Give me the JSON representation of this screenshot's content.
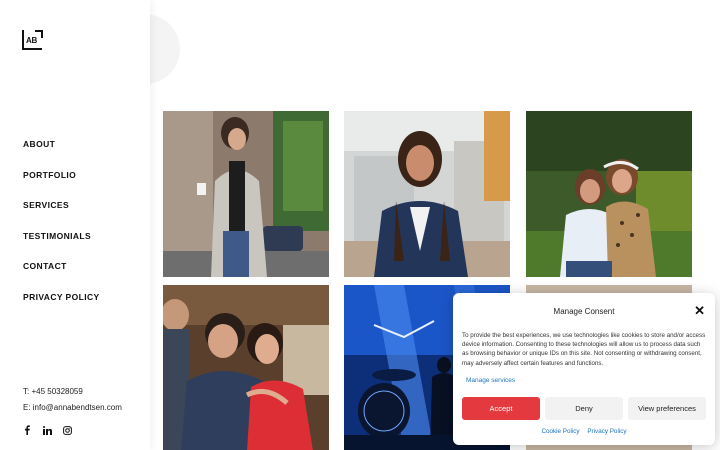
{
  "logo": {
    "text": "AB"
  },
  "nav": {
    "items": [
      {
        "label": "ABOUT"
      },
      {
        "label": "PORTFOLIO"
      },
      {
        "label": "SERVICES"
      },
      {
        "label": "TESTIMONIALS"
      },
      {
        "label": "CONTACT"
      },
      {
        "label": "PRIVACY POLICY"
      }
    ]
  },
  "contact": {
    "phone": "T: +45 50328059",
    "email": "E: info@annabendtsen.com"
  },
  "socials": [
    "facebook-icon",
    "linkedin-icon",
    "instagram-icon"
  ],
  "gallery": {
    "photos": [
      "woman-in-trench-coat-street",
      "woman-in-blue-blazer-smiling",
      "two-women-in-park",
      "couple-at-event",
      "drummer-on-stage",
      "partial-photo"
    ]
  },
  "consent": {
    "title": "Manage Consent",
    "body": "To provide the best experiences, we use technologies like cookies to store and/or access device information. Consenting to these technologies will allow us to process data such as browsing behavior or unique IDs on this site. Not consenting or withdrawing consent, may adversely affect certain features and functions.",
    "manage_services": "Manage services",
    "accept": "Accept",
    "deny": "Deny",
    "preferences": "View preferences",
    "cookie_policy": "Cookie Policy",
    "privacy_policy": "Privacy Policy"
  },
  "colors": {
    "accent": "#e4393f",
    "link": "#1e73be"
  }
}
